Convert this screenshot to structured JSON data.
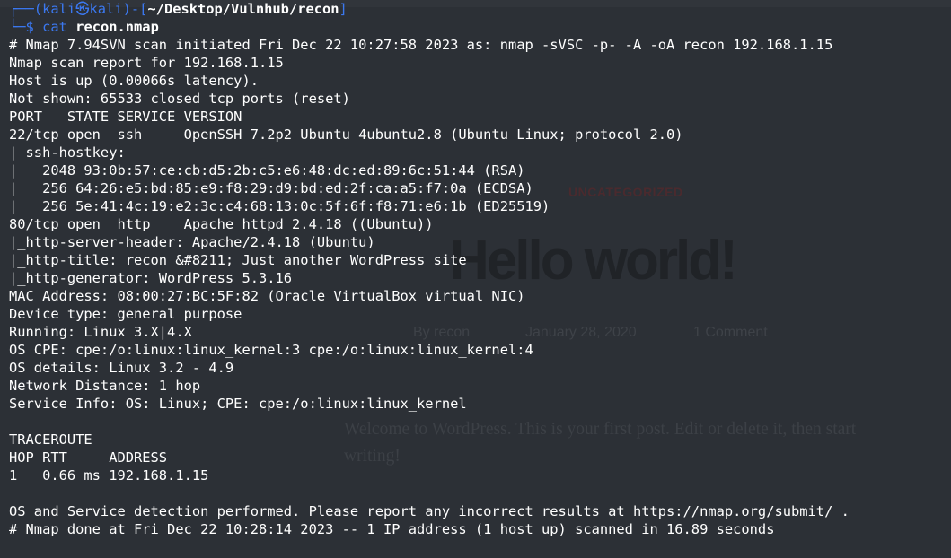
{
  "prompt": {
    "corner_top": "┌──(",
    "user_host": "kali㉿kali",
    "mid": ")-[",
    "path": "~/Desktop/Vulnhub/recon",
    "close": "]",
    "corner_bottom": "└─$ ",
    "command": "cat",
    "argument": "recon.nmap"
  },
  "output": [
    "# Nmap 7.94SVN scan initiated Fri Dec 22 10:27:58 2023 as: nmap -sVSC -p- -A -oA recon 192.168.1.15",
    "Nmap scan report for 192.168.1.15",
    "Host is up (0.00066s latency).",
    "Not shown: 65533 closed tcp ports (reset)",
    "PORT   STATE SERVICE VERSION",
    "22/tcp open  ssh     OpenSSH 7.2p2 Ubuntu 4ubuntu2.8 (Ubuntu Linux; protocol 2.0)",
    "| ssh-hostkey: ",
    "|   2048 93:0b:57:ce:cb:d5:2b:c5:e6:48:dc:ed:89:6c:51:44 (RSA)",
    "|   256 64:26:e5:bd:85:e9:f8:29:d9:bd:ed:2f:ca:a5:f7:0a (ECDSA)",
    "|_  256 5e:41:4c:19:e2:3c:c4:68:13:0c:5f:6f:f8:71:e6:1b (ED25519)",
    "80/tcp open  http    Apache httpd 2.4.18 ((Ubuntu))",
    "|_http-server-header: Apache/2.4.18 (Ubuntu)",
    "|_http-title: recon &#8211; Just another WordPress site",
    "|_http-generator: WordPress 5.3.16",
    "MAC Address: 08:00:27:BC:5F:82 (Oracle VirtualBox virtual NIC)",
    "Device type: general purpose",
    "Running: Linux 3.X|4.X",
    "OS CPE: cpe:/o:linux:linux_kernel:3 cpe:/o:linux:linux_kernel:4",
    "OS details: Linux 3.2 - 4.9",
    "Network Distance: 1 hop",
    "Service Info: OS: Linux; CPE: cpe:/o:linux:linux_kernel",
    "",
    "TRACEROUTE",
    "HOP RTT     ADDRESS",
    "1   0.66 ms 192.168.1.15",
    "",
    "OS and Service detection performed. Please report any incorrect results at https://nmap.org/submit/ .",
    "# Nmap done at Fri Dec 22 10:28:14 2023 -- 1 IP address (1 host up) scanned in 16.89 seconds"
  ],
  "background_page": {
    "category": "UNCATEGORIZED",
    "title": "Hello world!",
    "author": "By recon",
    "date": "January 28, 2020",
    "comments": "1 Comment",
    "body": "Welcome to WordPress. This is your first post. Edit or delete it, then start writing!"
  },
  "colors": {
    "background": "#2c3036",
    "prompt_blue": "#3b78f0",
    "text": "#ffffff"
  }
}
